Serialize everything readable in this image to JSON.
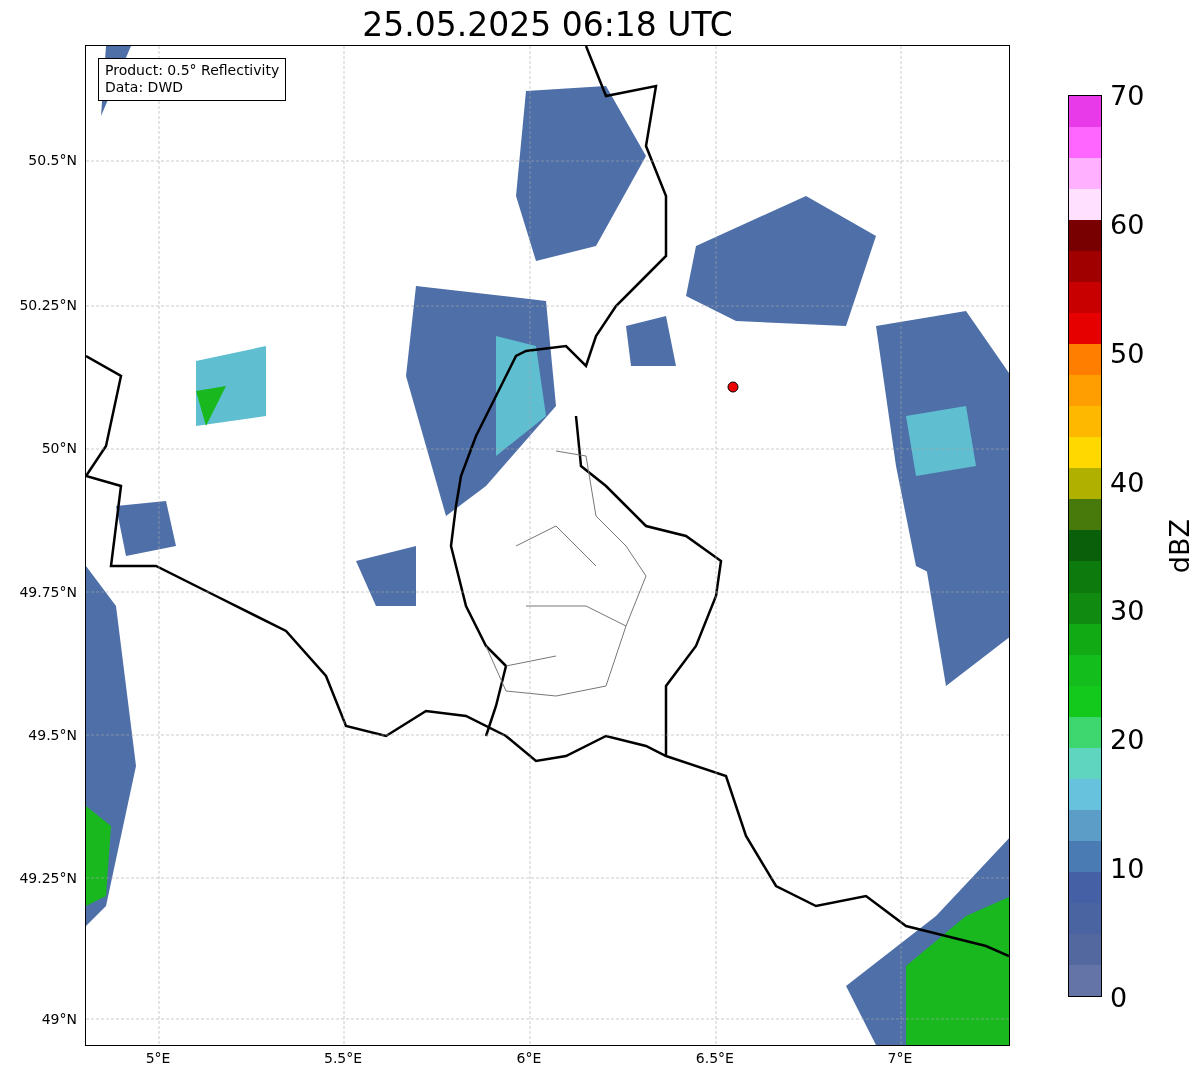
{
  "title": "25.05.2025 06:18 UTC",
  "map": {
    "info": [
      "Product: 0.5° Reflectivity",
      "Data: DWD"
    ],
    "lat_ticks": [
      "50.5°N",
      "50.25°N",
      "50°N",
      "49.75°N",
      "49.5°N",
      "49.25°N",
      "49°N"
    ],
    "lon_ticks": [
      "5°E",
      "5.5°E",
      "6°E",
      "6.5°E",
      "7°E"
    ]
  },
  "colorbar": {
    "label": "dBZ",
    "ticks": [
      "70",
      "60",
      "50",
      "40",
      "30",
      "20",
      "10",
      "0"
    ],
    "bands": [
      {
        "color": "#e83ae8"
      },
      {
        "color": "#ff66ff"
      },
      {
        "color": "#ffb0ff"
      },
      {
        "color": "#ffe0ff"
      },
      {
        "color": "#780000"
      },
      {
        "color": "#a00000"
      },
      {
        "color": "#c80000"
      },
      {
        "color": "#e60000"
      },
      {
        "color": "#ff7e00"
      },
      {
        "color": "#ff9e00"
      },
      {
        "color": "#ffb800"
      },
      {
        "color": "#ffd800"
      },
      {
        "color": "#b0b000"
      },
      {
        "color": "#477a0a"
      },
      {
        "color": "#0a5f0a"
      },
      {
        "color": "#0c7a0c"
      },
      {
        "color": "#108a10"
      },
      {
        "color": "#12aa14"
      },
      {
        "color": "#12bd1c"
      },
      {
        "color": "#12c91c"
      },
      {
        "color": "#3dd66f"
      },
      {
        "color": "#5fd5c0"
      },
      {
        "color": "#66c2dd"
      },
      {
        "color": "#5b9dc6"
      },
      {
        "color": "#4a7bb2"
      },
      {
        "color": "#4560a4"
      },
      {
        "color": "#4a64a2"
      },
      {
        "color": "#5468a0"
      },
      {
        "color": "#6574a6"
      }
    ]
  }
}
